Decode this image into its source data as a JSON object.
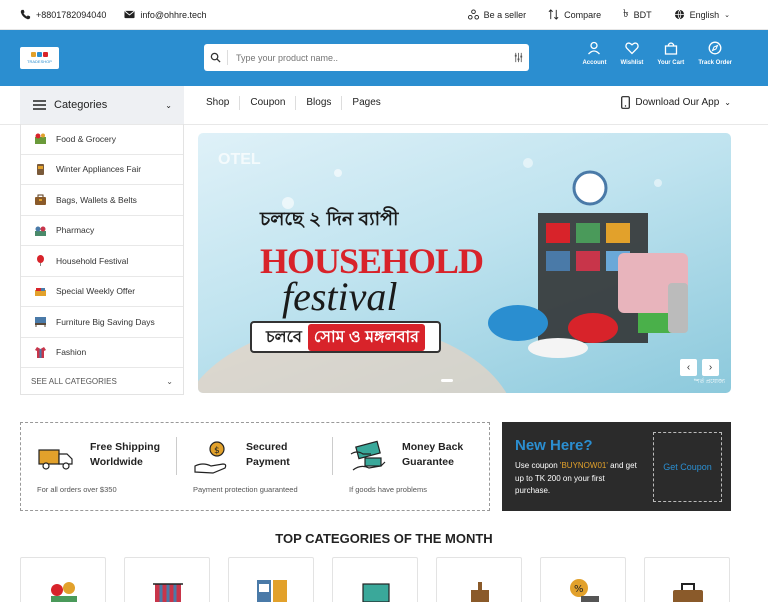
{
  "topbar": {
    "phone": "+8801782094040",
    "email": "info@ohhre.tech",
    "be_seller": "Be a seller",
    "compare": "Compare",
    "currency": "BDT",
    "language": "English"
  },
  "header": {
    "logo_text": "TRADESHOP",
    "search_placeholder": "Type your product name..",
    "icons": [
      {
        "label": "Account",
        "icon": "user-icon"
      },
      {
        "label": "Wishlist",
        "icon": "heart-icon"
      },
      {
        "label": "Your Cart",
        "icon": "bag-icon"
      },
      {
        "label": "Track Order",
        "icon": "compass-icon"
      }
    ]
  },
  "nav": {
    "categories_label": "Categories",
    "links": [
      "Shop",
      "Coupon",
      "Blogs",
      "Pages"
    ],
    "download_app": "Download Our App"
  },
  "categories": [
    {
      "label": "Food & Grocery",
      "color": "#6a9a3a"
    },
    {
      "label": "Winter Appliances Fair",
      "color": "#7a5a3a"
    },
    {
      "label": "Bags, Wallets & Belts",
      "color": "#8a5a2a"
    },
    {
      "label": "Pharmacy",
      "color": "#4a8a6a"
    },
    {
      "label": "Household Festival",
      "color": "#d8232a"
    },
    {
      "label": "Special Weekly Offer",
      "color": "#e29a2b"
    },
    {
      "label": "Furniture Big Saving Days",
      "color": "#4a7aa8"
    },
    {
      "label": "Fashion",
      "color": "#c8354a"
    }
  ],
  "see_all": "SEE ALL CATEGORIES",
  "banner": {
    "brand": "OTEL",
    "line1": "চলছে ২ দিন ব্যাপী",
    "line2": "HOUSEHOLD",
    "line3": "festival",
    "line4a": "চলবে",
    "line4b": "সোম ও মঙ্গলবার",
    "tag": "*শর্ত প্রযোজ্য"
  },
  "features": [
    {
      "title1": "Free Shipping",
      "title2": "Worldwide",
      "sub": "For all orders over $350",
      "icon": "truck-icon"
    },
    {
      "title1": "Secured",
      "title2": "Payment",
      "sub": "Payment protection guaranteed",
      "icon": "secure-payment-icon"
    },
    {
      "title1": "Money Back",
      "title2": "Guarantee",
      "sub": "If goods have problems",
      "icon": "money-back-icon"
    }
  ],
  "newhere": {
    "title": "New Here?",
    "desc_before": "Use coupon ",
    "code": "'BUYNOW01'",
    "desc_after": " and get up to TK 200 on your first purchase.",
    "button": "Get Coupon"
  },
  "top_categories_title": "TOP CATEGORIES OF THE MONTH",
  "colors": {
    "brand_blue": "#2b8ed0",
    "dark_panel": "#2b2b2b",
    "accent_orange": "#e2a12b"
  }
}
